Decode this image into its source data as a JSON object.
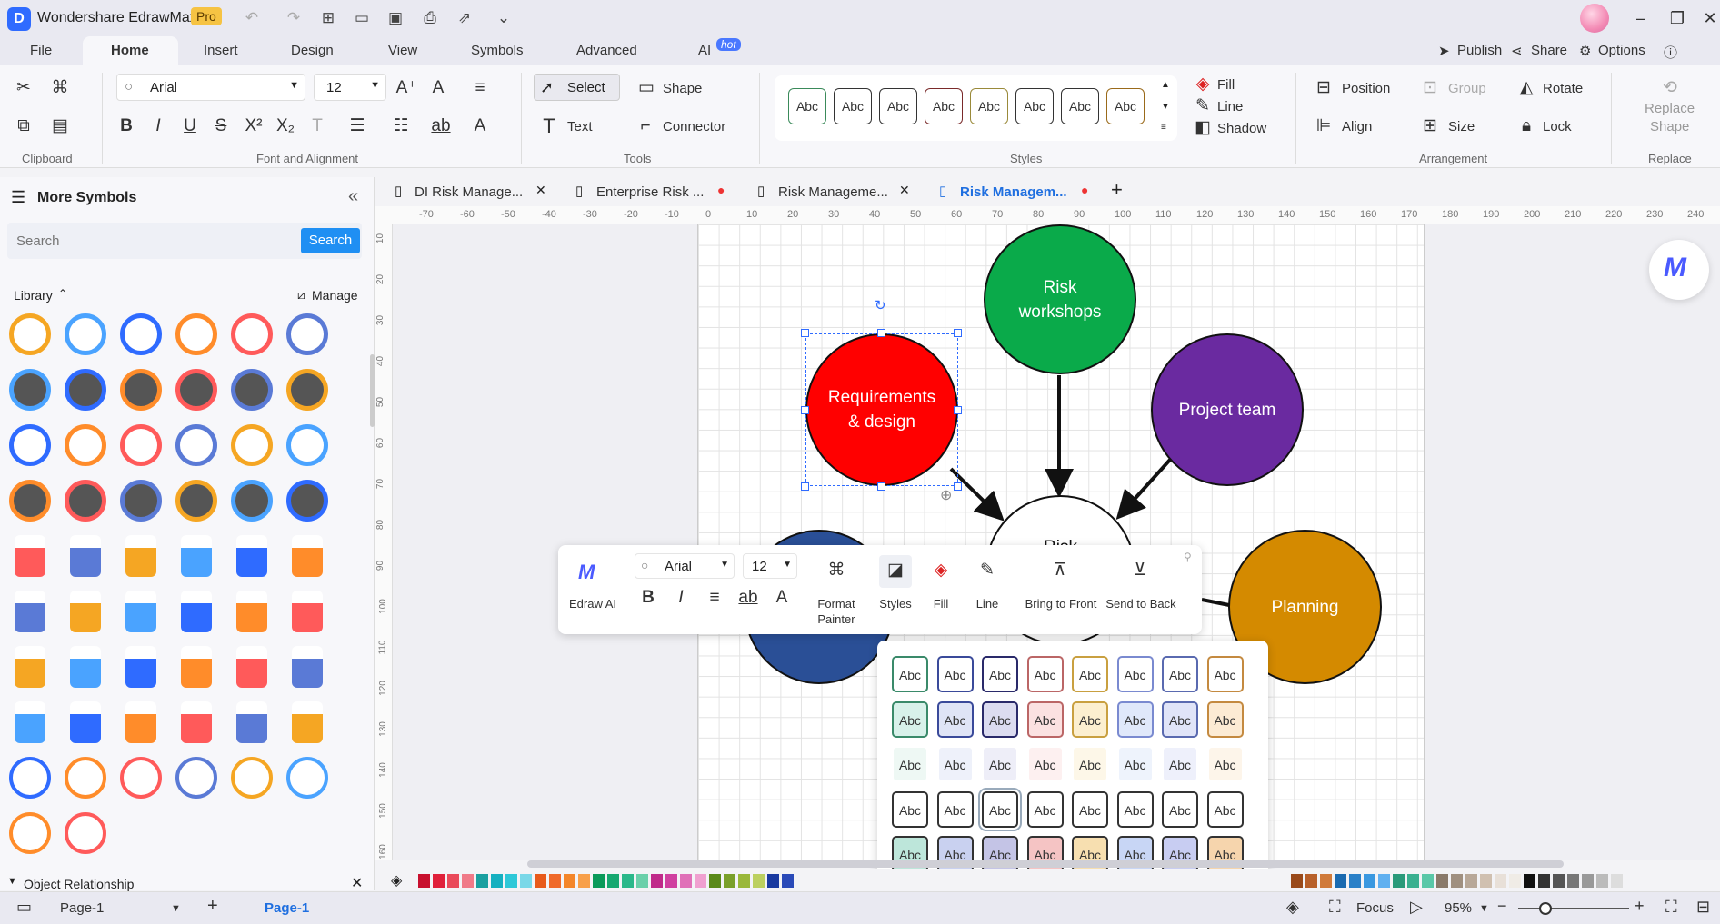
{
  "app": {
    "title": "Wondershare EdrawMax",
    "pro": "Pro"
  },
  "menu": {
    "file": "File",
    "home": "Home",
    "insert": "Insert",
    "design": "Design",
    "view": "View",
    "symbols": "Symbols",
    "advanced": "Advanced",
    "ai": "AI",
    "hot": "hot",
    "publish": "Publish",
    "share": "Share",
    "options": "Options"
  },
  "ribbon": {
    "font_name": "Arial",
    "font_size": "12",
    "select": "Select",
    "shape": "Shape",
    "text": "Text",
    "connector": "Connector",
    "fill": "Fill",
    "line": "Line",
    "shadow": "Shadow",
    "position": "Position",
    "group": "Group",
    "rotate": "Rotate",
    "align": "Align",
    "size": "Size",
    "lock": "Lock",
    "replace_shape_1": "Replace",
    "replace_shape_2": "Shape",
    "groups": {
      "clipboard": "Clipboard",
      "font": "Font and Alignment",
      "tools": "Tools",
      "styles": "Styles",
      "arrangement": "Arrangement",
      "replace": "Replace"
    },
    "style_label": "Abc"
  },
  "left": {
    "title": "More Symbols",
    "search_placeholder": "Search",
    "search_btn": "Search",
    "library": "Library",
    "manage": "Manage",
    "object_relationship": "Object Relationship"
  },
  "tabs": [
    {
      "label": "DI Risk Manage..."
    },
    {
      "label": "Enterprise Risk ..."
    },
    {
      "label": "Risk Manageme..."
    },
    {
      "label": "Risk Managem..."
    }
  ],
  "ruler_top": [
    "-70",
    "-60",
    "-50",
    "-40",
    "-30",
    "-20",
    "-10",
    "0",
    "10",
    "20",
    "30",
    "40",
    "50",
    "60",
    "70",
    "80",
    "90",
    "100",
    "110",
    "120",
    "130",
    "140",
    "150",
    "160",
    "170",
    "180",
    "190",
    "200",
    "210",
    "220",
    "230",
    "240"
  ],
  "ruler_left": [
    "10",
    "20",
    "30",
    "40",
    "50",
    "60",
    "70",
    "80",
    "90",
    "100",
    "110",
    "120",
    "130",
    "140",
    "150",
    "160"
  ],
  "diagram": {
    "workshops": "Risk workshops",
    "requirements": "Requirements & design",
    "project_team": "Project team",
    "planning": "Planning",
    "risk": "Risk",
    "colors": {
      "green": "#0aaa4a",
      "red": "#ff0000",
      "purple": "#6a2aa0",
      "orange": "#d48a00",
      "blue": "#2a4f96"
    }
  },
  "floatbar": {
    "edraw_ai": "Edraw AI",
    "font": "Arial",
    "size": "12",
    "format_painter_1": "Format",
    "format_painter_2": "Painter",
    "styles": "Styles",
    "fill": "Fill",
    "line": "Line",
    "bring_front": "Bring to Front",
    "send_back": "Send to Back"
  },
  "status": {
    "page_select": "Page-1",
    "page_tab": "Page-1",
    "focus": "Focus",
    "zoom": "95%"
  }
}
